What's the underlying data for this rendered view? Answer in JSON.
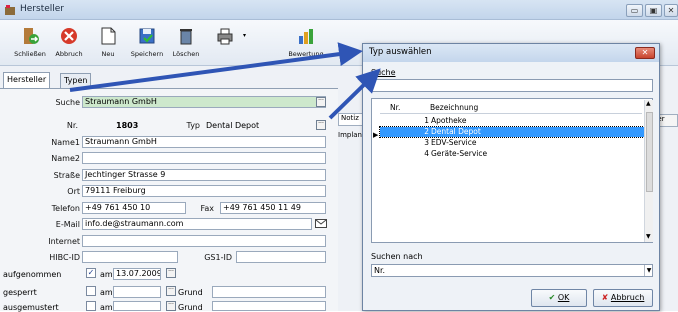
{
  "main_window": {
    "title": "Hersteller",
    "controls": {
      "minimize": "▭",
      "maximize": "▣",
      "close": "✕"
    }
  },
  "toolbar": {
    "buttons": [
      {
        "label": "Schließen",
        "icon": "exit-door-icon"
      },
      {
        "label": "Abbruch",
        "icon": "cancel-icon"
      },
      {
        "label": "Neu",
        "icon": "new-document-icon"
      },
      {
        "label": "Speichern",
        "icon": "save-icon"
      },
      {
        "label": "Löschen",
        "icon": "delete-icon"
      },
      {
        "label": "",
        "icon": "print-icon"
      },
      {
        "label": "Bewertung",
        "icon": "rating-chart-icon"
      }
    ],
    "colors": {
      "accent": "#2f55b5"
    }
  },
  "tabs": [
    "Hersteller",
    "Typen"
  ],
  "form": {
    "suche_label": "Suche",
    "suche_value": "Straumann GmbH",
    "nr_label": "Nr.",
    "nr_value": "1803",
    "typ_label": "Typ",
    "typ_value": "Dental Depot",
    "name1_label": "Name1",
    "name1_value": "Straumann GmbH",
    "name2_label": "Name2",
    "name2_value": "",
    "strasse_label": "Straße",
    "strasse_value": "Jechtinger Strasse 9",
    "ort_label": "Ort",
    "ort_value": "79111 Freiburg",
    "telefon_label": "Telefon",
    "telefon_value": "+49 761 450 10",
    "fax_label": "Fax",
    "fax_value": "+49 761 450 11 49",
    "email_label": "E-Mail",
    "email_value": "info.de@straumann.com",
    "internet_label": "Internet",
    "internet_value": "",
    "hibc_label": "HIBC-ID",
    "hibc_value": "",
    "gs1_label": "GS1-ID",
    "gs1_value": "",
    "aufgenommen_label": "aufgenommen",
    "aufgenommen_checked": "✓",
    "am_label": "am",
    "aufgenommen_date": "13.07.2009",
    "gesperrt_label": "gesperrt",
    "ausgemustert_label": "ausgemustert",
    "grund_label": "Grund"
  },
  "background_panel": {
    "notiz_tab": "Notiz",
    "implan_text": "Implan",
    "ner_tab": "ner"
  },
  "dialog": {
    "title": "Typ auswählen",
    "search_label": "Suche",
    "search_value": "",
    "columns": [
      "Nr.",
      "Bezeichnung"
    ],
    "rows": [
      {
        "nr": "1",
        "bez": "Apotheke"
      },
      {
        "nr": "2",
        "bez": "Dental Depot"
      },
      {
        "nr": "3",
        "bez": "EDV-Service"
      },
      {
        "nr": "4",
        "bez": "Geräte-Service"
      }
    ],
    "selected_row": 2,
    "suchen_nach_label": "Suchen nach",
    "suchen_nach_value": "Nr.",
    "ok_label": "OK",
    "abbruch_label": "Abbruch",
    "colors": {
      "selection": "#3399ff",
      "ok_check": "#2a8a2a",
      "cancel_x": "#cc2222"
    }
  }
}
